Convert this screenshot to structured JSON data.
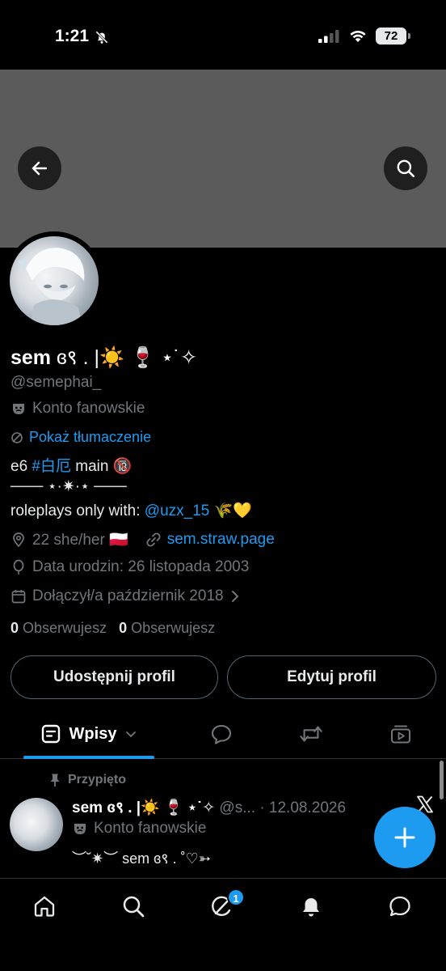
{
  "status_bar": {
    "time": "1:21",
    "battery": "72"
  },
  "profile": {
    "display_name": "sem",
    "display_name_deco": " ɞ९ . |☀️ 🍷  ⋆˙✧",
    "handle": "@semephai_",
    "account_label": "Konto fanowskie",
    "translate_label": "Pokaż tłumaczenie",
    "bio": {
      "line1_prefix": "e6 ",
      "line1_tag": "#白厄",
      "line1_suffix": " main 🔞",
      "line2": "─── ⋆·✷·⋆ ───",
      "line3_prefix": "roleplays only with: ",
      "line3_mention": "@uzx_15",
      "line3_suffix": " 🌾💛"
    },
    "location": "22 she/her 🇵🇱",
    "link": "sem.straw.page",
    "birthday": "Data urodzin: 26 listopada 2003",
    "joined": "Dołączył/a październik 2018",
    "following_count": "0",
    "following_label": "Obserwujesz",
    "followers_count": "0",
    "followers_label": "Obserwujesz"
  },
  "buttons": {
    "share_profile": "Udostępnij profil",
    "edit_profile": "Edytuj profil"
  },
  "tabs": {
    "posts_label": "Wpisy"
  },
  "pinned_post": {
    "pinned_label": "Przypięto",
    "author_name": "sem ɞ९ . |☀️ 🍷 ⋆˙✧",
    "author_handle_date": " @s... · 12.08.2026",
    "account_label": "Konto fanowskie",
    "text": "︶˘✷︶ sem ɞ९ . ˚♡➳"
  },
  "nav": {
    "notifications_badge": "1"
  },
  "colors": {
    "accent": "#1d9bf0",
    "background": "#000000",
    "banner": "#5b5b5b",
    "muted_text": "#71767b"
  }
}
